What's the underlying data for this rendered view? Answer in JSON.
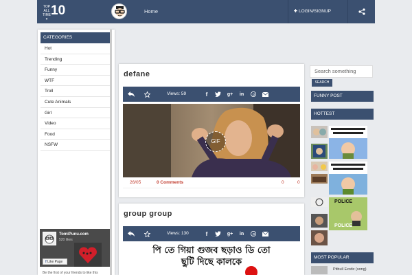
{
  "topbar": {
    "top_all_time": [
      "TOP",
      "ALL",
      "TIME"
    ],
    "top_number": "10",
    "home": "Home",
    "login": "LOGIN/SIGNUP",
    "login_icon": "plus-icon",
    "share_icon": "share-icon"
  },
  "categories": {
    "header": "CATEGORIES",
    "items": [
      "Hot",
      "Trending",
      "Funny",
      "WTF",
      "Troll",
      "Cute Animals",
      "Girl",
      "Video",
      "Food",
      "NSFW"
    ]
  },
  "fb_widget": {
    "name": "TomiPunu.com",
    "likes": "520 likes",
    "like_button": "Like Page",
    "footer_text": "Be the first of your friends to like this"
  },
  "posts": [
    {
      "title": "defane",
      "views": "Views: 59",
      "date": "26/05",
      "comments": "0 Comments",
      "count_a": "0",
      "count_b": "0",
      "media_badge": "GIF"
    },
    {
      "title": "group group",
      "views": "Views: 130",
      "caption_line1": "পি তে গিয়া গুজব ছড়াও ডি তো",
      "caption_line2": "ছুটি দিছে কালকে"
    }
  ],
  "right": {
    "search_placeholder": "Search something",
    "search_button": "SEARCH",
    "funny_post": "FUNNY POST",
    "hottest": "HOTTEST",
    "most_popular": "MOST POPULAR",
    "popular_item": "Pitbull Exotic (song)",
    "thumb_text_1": "POLICE",
    "thumb_text_2": "POLICE"
  },
  "colors": {
    "navy": "#3b5070",
    "accent_red": "#c0392b",
    "background": "#e9ebee"
  }
}
